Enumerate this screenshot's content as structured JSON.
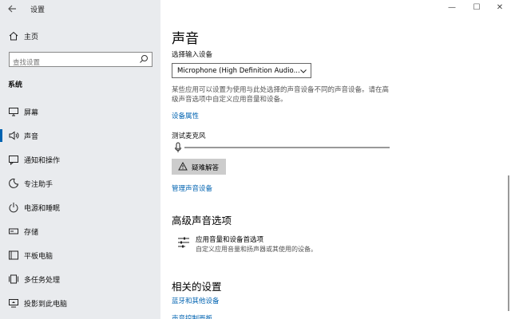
{
  "window": {
    "back_icon": "back-arrow-icon",
    "title": "设置",
    "controls": {
      "minimize": "—",
      "maximize": "☐",
      "close": "✕"
    }
  },
  "sidebar": {
    "home_label": "主页",
    "search_placeholder": "查找设置",
    "section_title": "系统",
    "items": [
      {
        "label": "屏幕",
        "icon": "monitor-icon",
        "active": false
      },
      {
        "label": "声音",
        "icon": "speaker-icon",
        "active": true
      },
      {
        "label": "通知和操作",
        "icon": "notification-icon",
        "active": false
      },
      {
        "label": "专注助手",
        "icon": "moon-icon",
        "active": false
      },
      {
        "label": "电源和睡眠",
        "icon": "power-icon",
        "active": false
      },
      {
        "label": "存储",
        "icon": "storage-icon",
        "active": false
      },
      {
        "label": "平板电脑",
        "icon": "tablet-icon",
        "active": false
      },
      {
        "label": "多任务处理",
        "icon": "multitask-icon",
        "active": false
      },
      {
        "label": "投影到此电脑",
        "icon": "projector-icon",
        "active": false
      }
    ]
  },
  "main": {
    "title": "声音",
    "input_device_label": "选择输入设备",
    "input_device_value": "Microphone (High Definition Audio...",
    "description_line1": "某些应用可以设置为使用与此处选择的声音设备不同的声音设备。请在高",
    "description_line2": "级声音选项中自定义应用音量和设备。",
    "device_properties_link": "设备属性",
    "test_mic_label": "测试麦克风",
    "troubleshoot_label": "疑难解答",
    "manage_devices_link": "管理声音设备",
    "advanced_title": "高级声音选项",
    "app_volume_title": "应用音量和设备首选项",
    "app_volume_desc": "自定义应用音量和扬声器或其使用的设备。",
    "related_title": "相关的设置",
    "bluetooth_link": "蓝牙和其他设备",
    "cut_link": "声音控制面板"
  },
  "colors": {
    "sidebar_bg": "#e9ebee",
    "accent": "#0063b1",
    "button_bg": "#cccccc"
  }
}
